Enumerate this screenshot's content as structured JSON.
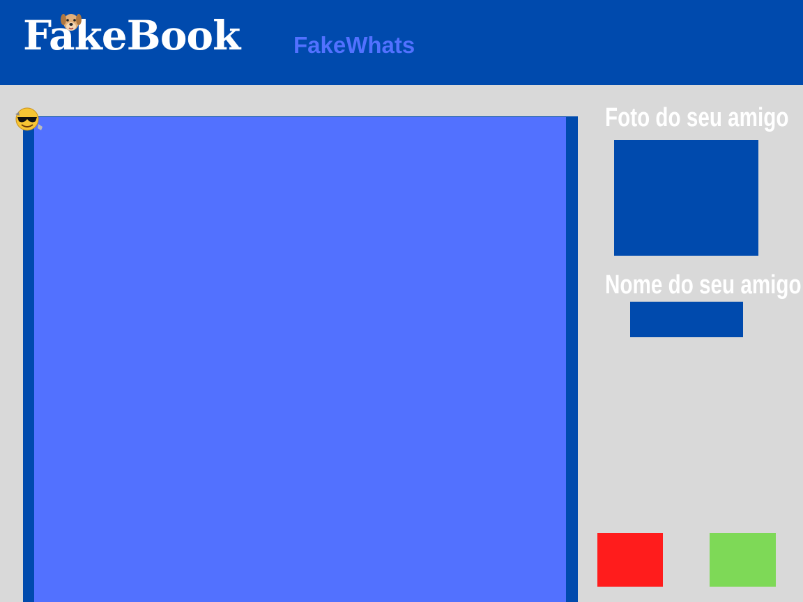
{
  "header": {
    "logo_text": "FakeBook",
    "app_name": "FakeWhats",
    "logo_icon": "dog-icon"
  },
  "chat": {
    "icon": "cool-emoji-icon"
  },
  "sidebar": {
    "photo_label": "Foto do seu amigo",
    "name_label": "Nome do seu amigo"
  },
  "colors": {
    "header": "#004aad",
    "background": "#d9d9d9",
    "accent": "#5271ff",
    "red_button": "#ff1c1c",
    "green_button": "#7ed957"
  }
}
